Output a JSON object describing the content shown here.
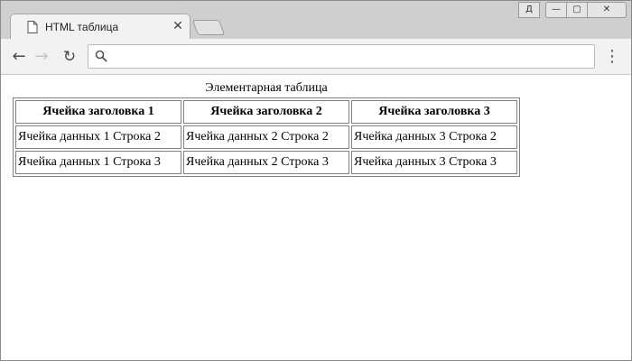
{
  "browser": {
    "tab": {
      "title": "HTML таблица",
      "icon": "document-icon",
      "close_glyph": "✕"
    },
    "window_controls": {
      "user_glyph": "Д",
      "minimize_glyph": "—",
      "maximize_glyph": "▢",
      "close_glyph": "✕"
    },
    "toolbar": {
      "back_glyph": "←",
      "forward_glyph": "→",
      "reload_glyph": "↻",
      "menu_glyph": "⋮",
      "address_value": "",
      "address_placeholder": ""
    }
  },
  "page": {
    "table": {
      "caption": "Элементарная таблица",
      "headers": [
        "Ячейка заголовка 1",
        "Ячейка заголовка 2",
        "Ячейка заголовка 3"
      ],
      "rows": [
        [
          "Ячейка данных 1 Строка 2",
          "Ячейка данных 2 Строка 2",
          "Ячейка данных 3 Строка 2"
        ],
        [
          "Ячейка данных 1 Строка 3",
          "Ячейка данных 2 Строка 3",
          "Ячейка данных 3 Строка 3"
        ]
      ]
    }
  },
  "colors": {
    "tabstrip_bg": "#cfcfcf",
    "toolbar_bg": "#f2f2f2",
    "table_border": "#808080"
  }
}
